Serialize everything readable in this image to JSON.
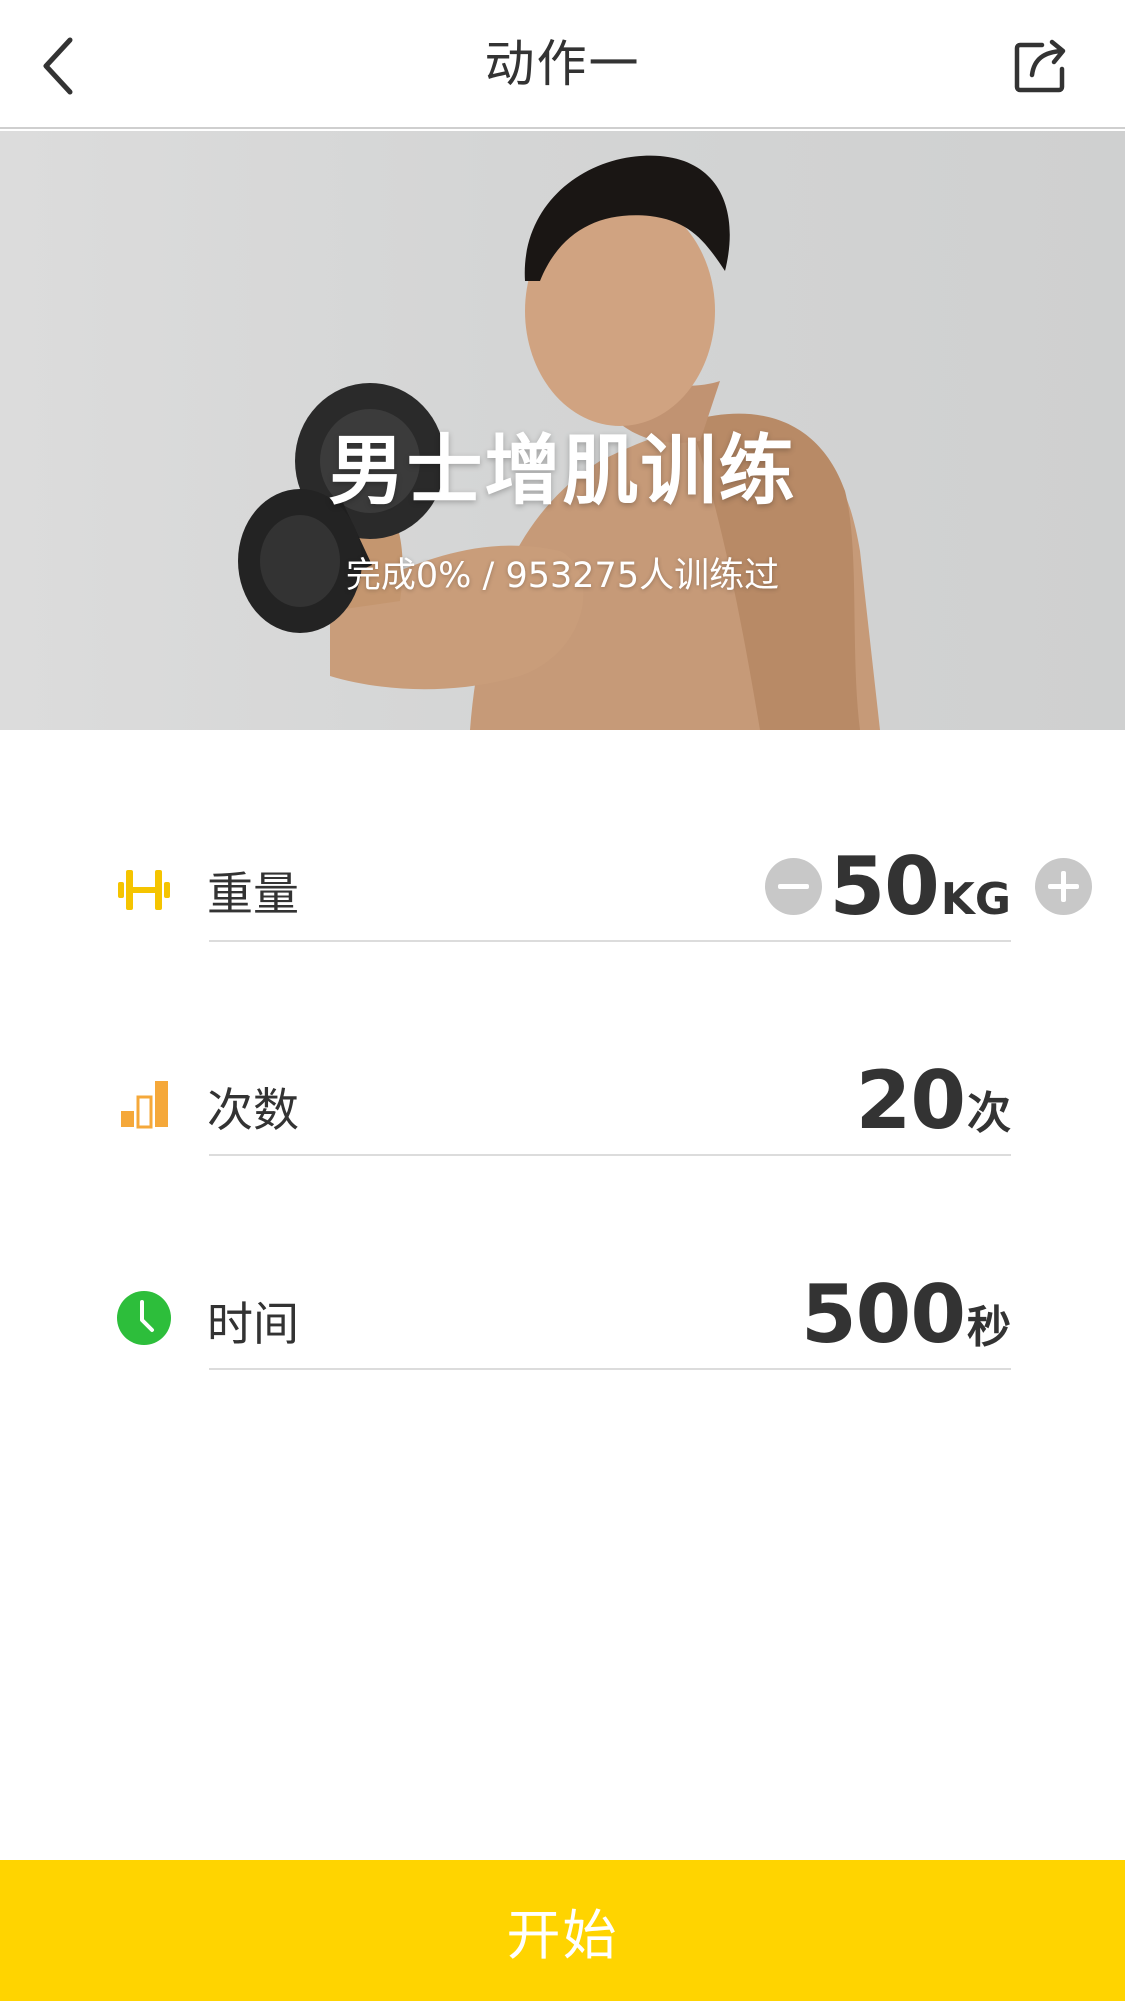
{
  "header": {
    "title": "动作一",
    "back_icon": "chevron-left-icon",
    "share_icon": "share-icon"
  },
  "hero": {
    "title": "男士增肌训练",
    "subtitle": "完成0% / 953275人训练过"
  },
  "settings": {
    "weight": {
      "label": "重量",
      "value": "50",
      "unit": "KG",
      "icon": "dumbbell-icon",
      "icon_color": "#F5C400"
    },
    "reps": {
      "label": "次数",
      "value": "20",
      "unit": "次",
      "icon": "bar-chart-icon",
      "icon_color": "#F5A83A"
    },
    "time": {
      "label": "时间",
      "value": "500",
      "unit": "秒",
      "icon": "clock-icon",
      "icon_color": "#2DBE3B"
    }
  },
  "controls": {
    "decrease_icon": "minus-circle-icon",
    "increase_icon": "plus-circle-icon"
  },
  "start_button": {
    "label": "开始",
    "color": "#FFD400"
  }
}
